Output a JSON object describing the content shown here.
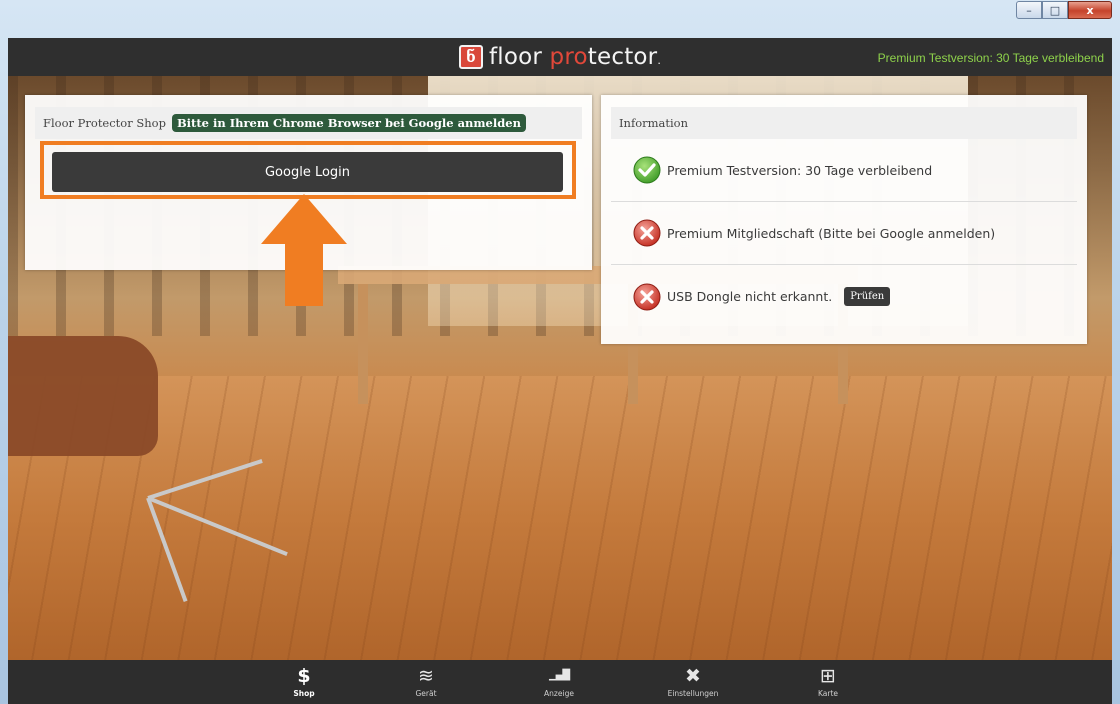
{
  "window": {
    "controls": {
      "minimize": "–",
      "maximize": "□",
      "close": "x"
    }
  },
  "header": {
    "logo_part1": "floor ",
    "logo_part2": "pro",
    "logo_part3": "tector",
    "logo_badge": "ნ",
    "status": "Premium Testversion: 30 Tage verbleibend",
    "status_color": "#8ed24b"
  },
  "shop": {
    "title": "Floor Protector Shop",
    "badge": "Bitte in Ihrem Chrome Browser bei Google anmelden",
    "login_button": "Google Login",
    "highlight_color": "#f07d22"
  },
  "info": {
    "title": "Information",
    "rows": [
      {
        "icon": "check-icon",
        "text": "Premium Testversion:  30 Tage verbleibend"
      },
      {
        "icon": "error-icon",
        "text": "Premium Mitgliedschaft  (Bitte bei Google anmelden)"
      },
      {
        "icon": "error-icon",
        "text": "USB Dongle nicht erkannt.",
        "button": "Prüfen"
      }
    ]
  },
  "nav": {
    "items": [
      {
        "label": "Shop",
        "icon": "dollar-icon",
        "glyph": "$",
        "active": true
      },
      {
        "label": "Gerät",
        "icon": "layers-icon",
        "glyph": "≋",
        "active": false
      },
      {
        "label": "Anzeige",
        "icon": "bar-chart-icon",
        "glyph": "▁▄█",
        "active": false
      },
      {
        "label": "Einstellungen",
        "icon": "tools-icon",
        "glyph": "✖",
        "active": false
      },
      {
        "label": "Karte",
        "icon": "map-icon",
        "glyph": "⊞",
        "active": false
      }
    ]
  }
}
